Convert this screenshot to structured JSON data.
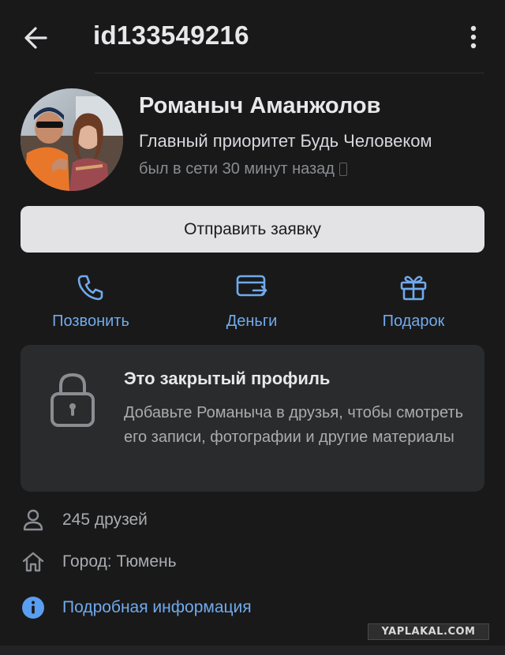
{
  "header": {
    "title": "id133549216",
    "back_icon": "arrow-left-icon",
    "more_icon": "more-vertical-icon"
  },
  "profile": {
    "name": "Романыч Аманжолов",
    "status": "Главный приоритет Будь Человеком",
    "online": "был в сети 30 минут назад",
    "online_device_icon": "mobile-phone-icon"
  },
  "request_button": {
    "label": "Отправить заявку"
  },
  "actions": [
    {
      "label": "Позвонить",
      "icon": "phone-call-icon"
    },
    {
      "label": "Деньги",
      "icon": "money-transfer-icon"
    },
    {
      "label": "Подарок",
      "icon": "gift-icon"
    }
  ],
  "closed_profile": {
    "title": "Это закрытый профиль",
    "text": "Добавьте Романыча в друзья, чтобы смотреть его записи, фотографии и другие материалы",
    "icon": "lock-icon"
  },
  "info": {
    "friends": "245 друзей",
    "city": "Город: Тюмень",
    "more": "Подробная информация"
  },
  "watermark": "YAPLAKAL.COM",
  "colors": {
    "background": "#19191a",
    "accent": "#71aaeb",
    "card": "#2a2b2d",
    "button": "#e3e3e6"
  }
}
